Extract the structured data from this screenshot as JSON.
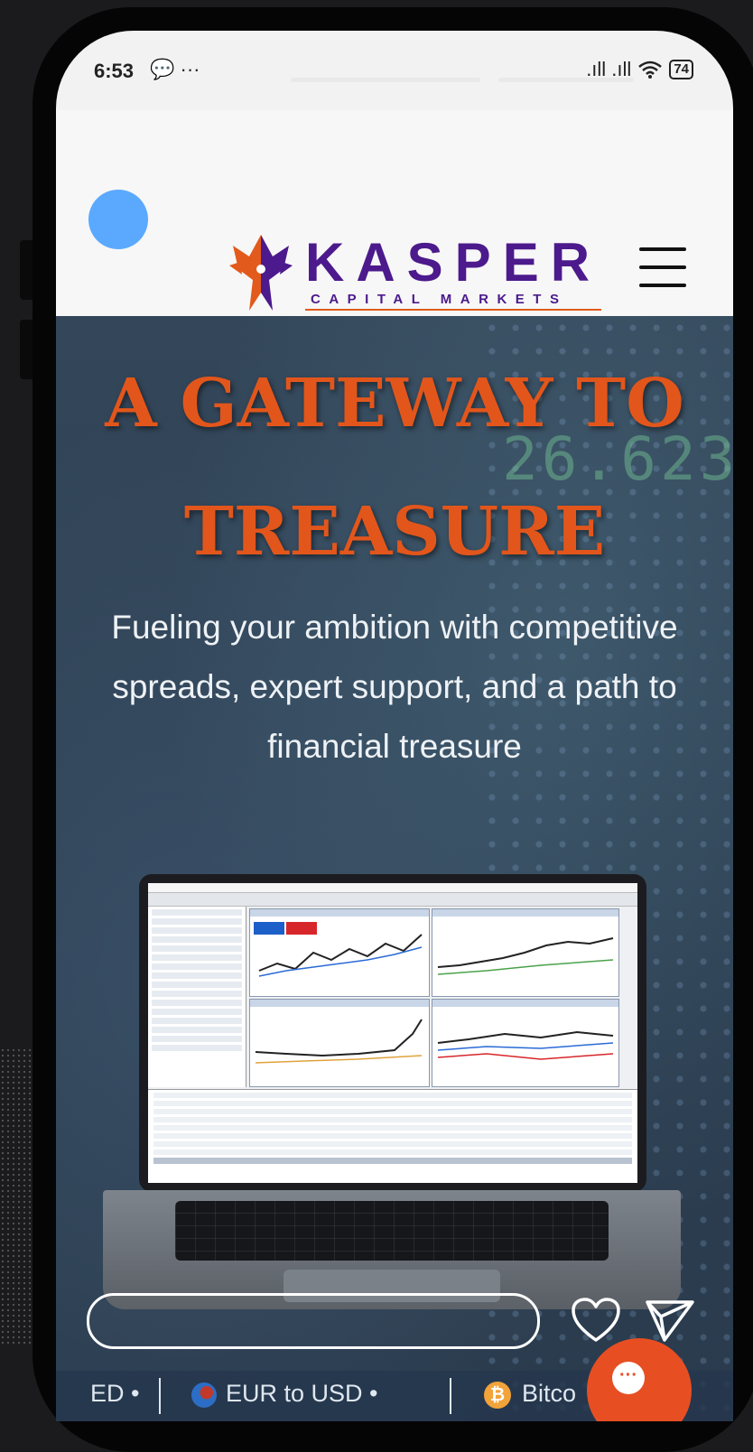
{
  "status_bar": {
    "time": "6:53",
    "notification_glyphs": "💬 ···",
    "signal_glyphs": ".ıll .ıll",
    "battery": "74"
  },
  "header": {
    "logo_title": "KASPER",
    "logo_subtitle": "CAPITAL MARKETS",
    "colors": {
      "brand_purple": "#4c1a8c",
      "brand_orange": "#e25a1c"
    }
  },
  "hero": {
    "title_line1": "A GATEWAY TO",
    "title_line2": "TREASURE",
    "subtitle": "Fueling your ambition with competitive spreads, expert support, and a path to financial treasure",
    "background_number": "26.623"
  },
  "actions": {
    "comment_placeholder": "",
    "like_icon": "heart-icon",
    "share_icon": "send-icon"
  },
  "ticker": {
    "item_left": "ED •",
    "item_middle": "EUR to USD •",
    "item_right": "Bitco"
  },
  "chat": {
    "label": "···"
  }
}
